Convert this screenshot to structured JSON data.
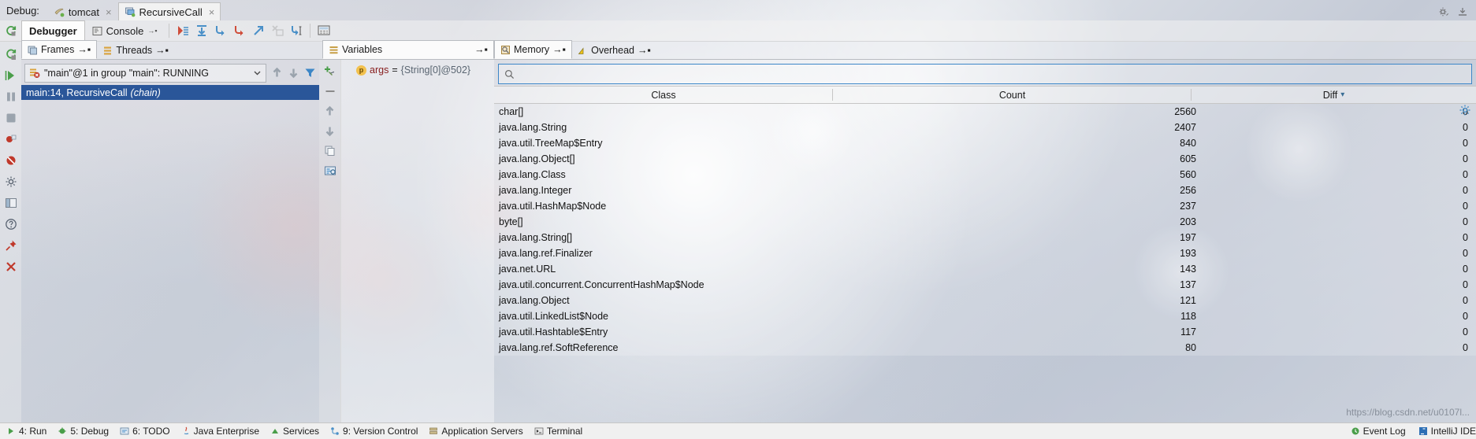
{
  "window": {
    "debug_label": "Debug:",
    "tabs": [
      {
        "label": "tomcat",
        "icon": "tomcat-icon",
        "active": false,
        "close": "×"
      },
      {
        "label": "RecursiveCall",
        "icon": "run-config-icon",
        "active": true,
        "close": "×"
      }
    ],
    "header_actions": [
      {
        "name": "settings-icon",
        "label": "⚙"
      },
      {
        "name": "hide-icon",
        "label": "—"
      }
    ]
  },
  "toolbar": {
    "rerun_icon": "rerun-icon",
    "tabs": [
      {
        "label": "Debugger",
        "active": true,
        "pin": ""
      },
      {
        "label": "Console",
        "active": false,
        "pin": "→▪",
        "icon": "console-icon"
      }
    ],
    "buttons": [
      {
        "name": "resume-program-button",
        "icon": "resume-icon"
      },
      {
        "name": "step-over-button",
        "icon": "step-over-icon"
      },
      {
        "name": "step-into-button",
        "icon": "step-into-icon"
      },
      {
        "name": "force-step-into-button",
        "icon": "force-step-into-icon"
      },
      {
        "name": "step-out-button",
        "icon": "step-out-icon"
      },
      {
        "name": "drop-frame-button",
        "icon": "drop-frame-icon"
      },
      {
        "name": "run-to-cursor-button",
        "icon": "run-to-cursor-icon"
      },
      {
        "name": "evaluate-expression-button",
        "icon": "evaluate-icon"
      }
    ]
  },
  "left_strip": [
    {
      "name": "rerun-icon"
    },
    {
      "name": "resume-program-icon"
    },
    {
      "name": "pause-program-icon"
    },
    {
      "name": "stop-icon"
    },
    {
      "name": "view-breakpoints-icon"
    },
    {
      "name": "mute-breakpoints-icon"
    },
    {
      "name": "settings-icon"
    },
    {
      "name": "layout-icon"
    },
    {
      "name": "help-icon"
    },
    {
      "name": "pin-icon"
    },
    {
      "name": "close-icon"
    }
  ],
  "frames": {
    "tabs": [
      {
        "label": "Frames",
        "pin": "→▪",
        "active": true,
        "icon": "frames-icon"
      },
      {
        "label": "Threads",
        "pin": "→▪",
        "active": false,
        "icon": "threads-icon"
      }
    ],
    "thread_selector": {
      "value": "\"main\"@1 in group \"main\": RUNNING",
      "icon": "thread-suspended-icon",
      "chevron": "⌄"
    },
    "nav_buttons": [
      {
        "name": "frame-up-button",
        "icon": "arrow-up-icon"
      },
      {
        "name": "frame-down-button",
        "icon": "arrow-down-icon"
      },
      {
        "name": "filter-frames-button",
        "icon": "filter-icon"
      }
    ],
    "stack": [
      {
        "text": "main:14, RecursiveCall",
        "suffix": "(chain)",
        "selected": true
      }
    ]
  },
  "variables": {
    "tab": {
      "label": "Variables",
      "pin": "→▪",
      "icon": "variables-icon"
    },
    "tools": [
      {
        "name": "new-watch-button",
        "icon": "add-watch-icon"
      },
      {
        "name": "remove-watch-button",
        "icon": "minus-icon"
      },
      {
        "name": "move-watch-up-button",
        "icon": "arrow-up-icon"
      },
      {
        "name": "move-watch-down-button",
        "icon": "arrow-down-icon"
      },
      {
        "name": "copy-value-button",
        "icon": "copy-icon"
      },
      {
        "name": "inspect-button",
        "icon": "inspect-icon"
      }
    ],
    "rows": [
      {
        "badge": "p",
        "name": "args",
        "eq": "=",
        "value": "{String[0]@502}"
      }
    ]
  },
  "memory": {
    "tabs": [
      {
        "label": "Memory",
        "pin": "→▪",
        "active": true,
        "icon": "memory-icon"
      },
      {
        "label": "Overhead",
        "pin": "→▪",
        "active": false,
        "icon": "overhead-icon"
      }
    ],
    "search": {
      "value": "",
      "placeholder": "",
      "icon": "search-icon"
    },
    "settings_icon": "gear-icon",
    "columns": [
      {
        "label": "Class",
        "sorted": false
      },
      {
        "label": "Count",
        "sorted": false
      },
      {
        "label": "Diff",
        "sorted": true,
        "sort_arrow": "▾"
      }
    ],
    "rows": [
      {
        "class": "char[]",
        "count": "2560",
        "diff": "0"
      },
      {
        "class": "java.lang.String",
        "count": "2407",
        "diff": "0"
      },
      {
        "class": "java.util.TreeMap$Entry",
        "count": "840",
        "diff": "0"
      },
      {
        "class": "java.lang.Object[]",
        "count": "605",
        "diff": "0"
      },
      {
        "class": "java.lang.Class",
        "count": "560",
        "diff": "0"
      },
      {
        "class": "java.lang.Integer",
        "count": "256",
        "diff": "0"
      },
      {
        "class": "java.util.HashMap$Node",
        "count": "237",
        "diff": "0"
      },
      {
        "class": "byte[]",
        "count": "203",
        "diff": "0"
      },
      {
        "class": "java.lang.String[]",
        "count": "197",
        "diff": "0"
      },
      {
        "class": "java.lang.ref.Finalizer",
        "count": "193",
        "diff": "0"
      },
      {
        "class": "java.net.URL",
        "count": "143",
        "diff": "0"
      },
      {
        "class": "java.util.concurrent.ConcurrentHashMap$Node",
        "count": "137",
        "diff": "0"
      },
      {
        "class": "java.lang.Object",
        "count": "121",
        "diff": "0"
      },
      {
        "class": "java.util.LinkedList$Node",
        "count": "118",
        "diff": "0"
      },
      {
        "class": "java.util.Hashtable$Entry",
        "count": "117",
        "diff": "0"
      },
      {
        "class": "java.lang.ref.SoftReference",
        "count": "80",
        "diff": "0"
      }
    ]
  },
  "status_bar": {
    "items": [
      {
        "label": "4: Run",
        "icon": "run-icon"
      },
      {
        "label": "5: Debug",
        "icon": "debug-icon"
      },
      {
        "label": "6: TODO",
        "icon": "todo-icon"
      },
      {
        "label": "Java Enterprise",
        "icon": "java-ee-icon"
      },
      {
        "label": "Services",
        "icon": "services-icon"
      },
      {
        "label": "9: Version Control",
        "icon": "vcs-icon"
      },
      {
        "label": "Application Servers",
        "icon": "app-servers-icon"
      },
      {
        "label": "Terminal",
        "icon": "terminal-icon"
      }
    ],
    "right_items": [
      {
        "label": "Event Log",
        "icon": "event-log-icon"
      },
      {
        "label": "IntelliJ IDEA",
        "icon": "idea-icon"
      }
    ]
  },
  "watermark": "https://blog.csdn.net/u0107l..."
}
